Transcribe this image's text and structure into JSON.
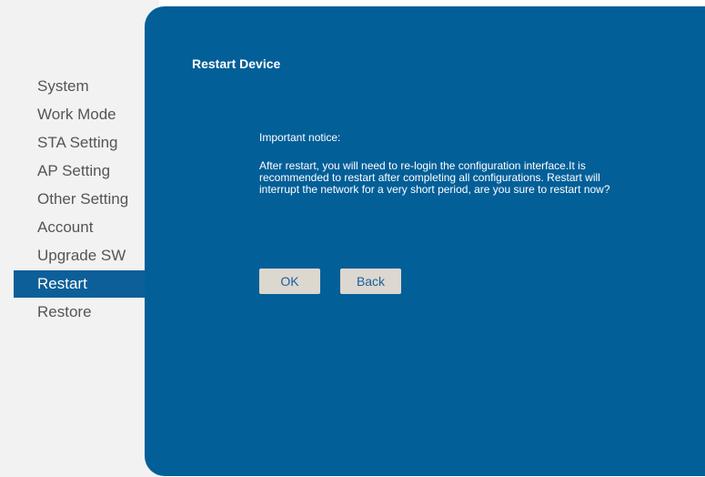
{
  "sidebar": {
    "items": [
      {
        "label": "System"
      },
      {
        "label": "Work Mode"
      },
      {
        "label": "STA Setting"
      },
      {
        "label": "AP Setting"
      },
      {
        "label": "Other Setting"
      },
      {
        "label": "Account"
      },
      {
        "label": "Upgrade SW"
      },
      {
        "label": "Restart"
      },
      {
        "label": "Restore"
      }
    ],
    "active": "Restart"
  },
  "panel": {
    "title": "Restart Device",
    "notice_heading": "Important notice:",
    "notice_body": "After restart, you will need to re-login the configuration interface.It is recommended to restart after completing all configurations. Restart will interrupt the network for a very short period, are you sure to restart now?",
    "ok_label": "OK",
    "back_label": "Back"
  },
  "colors": {
    "panel_background": "#035f98",
    "active_item": "#0c5f98",
    "button_background": "#dcd7cf",
    "button_text": "#1c5f9a"
  }
}
